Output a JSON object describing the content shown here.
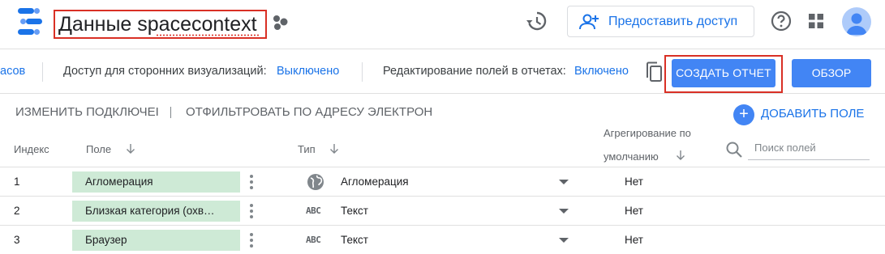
{
  "header": {
    "title": "Данные spacecontext",
    "share_label": "Предоставить доступ"
  },
  "toolbar": {
    "left_cut_text": "асов",
    "third_party_viz_label": "Доступ для сторонних визуализаций:",
    "third_party_viz_value": "Выключено",
    "report_edit_label": "Редактирование полей в отчетах:",
    "report_edit_value": "Включено",
    "create_report_label": "СОЗДАТЬ ОТЧЕТ",
    "overview_label": "ОБЗОР"
  },
  "actions": {
    "edit_connection": "ИЗМЕНИТЬ ПОДКЛЮЧЕI",
    "filter_by_email": "ОТФИЛЬТРОВАТЬ ПО АДРЕСУ ЭЛЕКТРОН",
    "add_field": "ДОБАВИТЬ ПОЛЕ"
  },
  "table": {
    "headers": {
      "index": "Индекс",
      "field": "Поле",
      "type": "Тип",
      "aggregation_line1": "Агрегирование по",
      "aggregation_line2": "умолчанию"
    },
    "search_placeholder": "Поиск полей",
    "rows": [
      {
        "index": "1",
        "field": "Агломерация",
        "type_icon": "globe-icon",
        "type": "Агломерация",
        "aggregation": "Нет"
      },
      {
        "index": "2",
        "field": "Близкая категория (охв…",
        "type_icon": "abc-text-icon",
        "type_glyph": "ABC",
        "type": "Текст",
        "aggregation": "Нет"
      },
      {
        "index": "3",
        "field": "Браузер",
        "type_icon": "abc-text-icon",
        "type_glyph": "ABC",
        "type": "Текст",
        "aggregation": "Нет"
      }
    ]
  },
  "colors": {
    "accent": "#4285f4",
    "link": "#1a73e8",
    "highlight_border": "#d93025",
    "field_chip": "#ceead6"
  }
}
